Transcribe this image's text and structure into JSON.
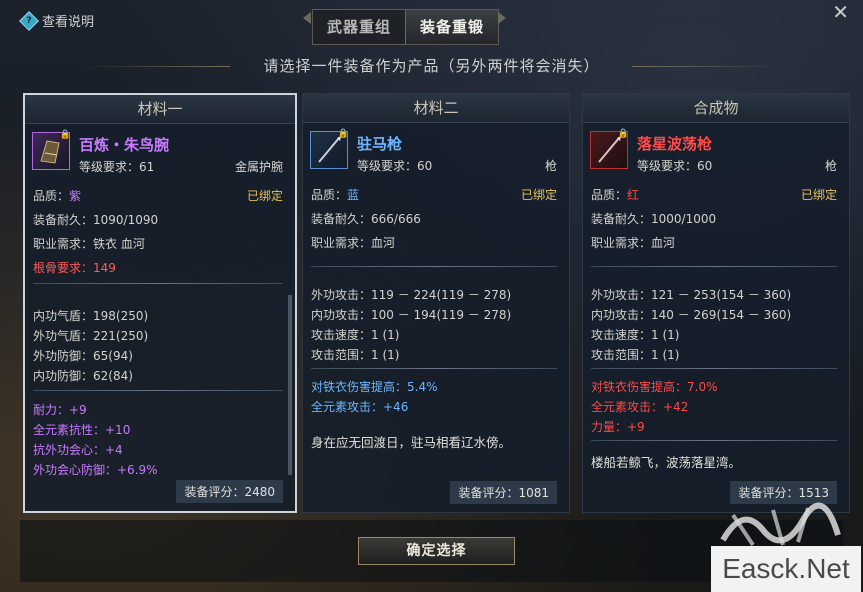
{
  "help": {
    "label": "查看说明"
  },
  "close": {
    "label": "✕"
  },
  "tabs": [
    {
      "label": "武器重组",
      "active": false
    },
    {
      "label": "装备重锻",
      "active": true
    }
  ],
  "subtitle": "请选择一件装备作为产品（另外两件将会消失）",
  "panels": [
    {
      "header": "材料一",
      "selected": true,
      "item_name": "百炼・朱鸟腕",
      "name_color": "#c77bff",
      "icon_border": "#b06ae0",
      "level_text": "等级要求：61",
      "type": "金属护腕",
      "quality_label": "品质：",
      "quality": "紫",
      "quality_color": "#c77bff",
      "bound": "已绑定",
      "durability": "装备耐久：1090/1090",
      "job_req": "职业需求：铁衣 血河",
      "bone_req": "根骨要求：149",
      "stats": [
        "内功气盾：198(250)",
        "外功气盾：221(250)",
        "外功防御：65(94)",
        "内功防御：62(84)"
      ],
      "extra": [
        {
          "text": "耐力：+9",
          "color": "#c77bff"
        },
        {
          "text": "全元素抗性：+10",
          "color": "#c77bff"
        },
        {
          "text": "抗外功会心：+4",
          "color": "#c77bff"
        },
        {
          "text": "外功会心防御：+6.9%",
          "color": "#c77bff"
        }
      ],
      "flavor": "",
      "score": "装备评分：2480"
    },
    {
      "header": "材料二",
      "selected": false,
      "item_name": "驻马枪",
      "name_color": "#6fb6ff",
      "icon_border": "#5a8fd0",
      "level_text": "等级要求：60",
      "type": "枪",
      "quality_label": "品质：",
      "quality": "蓝",
      "quality_color": "#6fb6ff",
      "bound": "已绑定",
      "durability": "装备耐久：666/666",
      "job_req": "职业需求：血河",
      "bone_req": "",
      "stats": [
        "外功攻击：119 － 224(119 － 278)",
        "内功攻击：100 － 194(119 － 278)",
        "攻击速度：1 (1)",
        "攻击范围：1 (1)"
      ],
      "extra": [
        {
          "text": "对铁衣伤害提高：5.4%",
          "color": "#6fb6ff"
        },
        {
          "text": "全元素攻击：+46",
          "color": "#6fb6ff"
        }
      ],
      "flavor": "身在应无回渡日，驻马相看辽水傍。",
      "score": "装备评分：1081"
    },
    {
      "header": "合成物",
      "selected": false,
      "item_name": "落星波荡枪",
      "name_color": "#ff4a4a",
      "icon_border": "#c03030",
      "level_text": "等级要求：60",
      "type": "枪",
      "quality_label": "品质：",
      "quality": "红",
      "quality_color": "#ff4a4a",
      "bound": "已绑定",
      "durability": "装备耐久：1000/1000",
      "job_req": "职业需求：血河",
      "bone_req": "",
      "stats": [
        "外功攻击：121 － 253(154 － 360)",
        "内功攻击：140 － 269(154 － 360)",
        "攻击速度：1 (1)",
        "攻击范围：1 (1)"
      ],
      "extra": [
        {
          "text": "对铁衣伤害提高：7.0%",
          "color": "#ff4a4a"
        },
        {
          "text": "全元素攻击：+42",
          "color": "#ff4a4a"
        },
        {
          "text": "力量：+9",
          "color": "#ff4a4a"
        }
      ],
      "flavor": "楼船若鲸飞，波荡落星湾。",
      "score": "装备评分：1513"
    }
  ],
  "confirm_label": "确定选择",
  "watermark": "Easck.Net"
}
